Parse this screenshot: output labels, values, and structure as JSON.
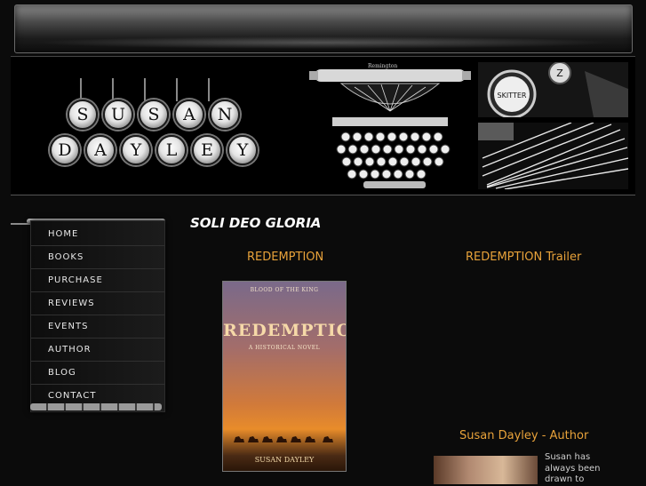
{
  "logo": {
    "row1": [
      "S",
      "U",
      "S",
      "A",
      "N"
    ],
    "row2": [
      "D",
      "A",
      "Y",
      "L",
      "E",
      "Y"
    ]
  },
  "photo": {
    "typewriter_brand": "Remington",
    "key_label": "SKITTER",
    "key_letter": "Z"
  },
  "nav": {
    "items": [
      "HOME",
      "BOOKS",
      "PURCHASE",
      "REVIEWS",
      "EVENTS",
      "AUTHOR",
      "BLOG",
      "CONTACT"
    ]
  },
  "main": {
    "heading": "SOLI DEO GLORIA",
    "left_title": "REDEMPTION",
    "right_title": "REDEMPTION Trailer",
    "author_title": "Susan Dayley - Author",
    "author_text": "Susan has always been drawn to"
  },
  "book": {
    "top_line": "BLOOD OF THE KING",
    "title": "REDEMPTION",
    "subtitle": "A HISTORICAL NOVEL",
    "author": "SUSAN DAYLEY"
  },
  "colors": {
    "accent": "#e8a23a",
    "background": "#0b0b0b",
    "nav_text": "#e8e8e8"
  }
}
